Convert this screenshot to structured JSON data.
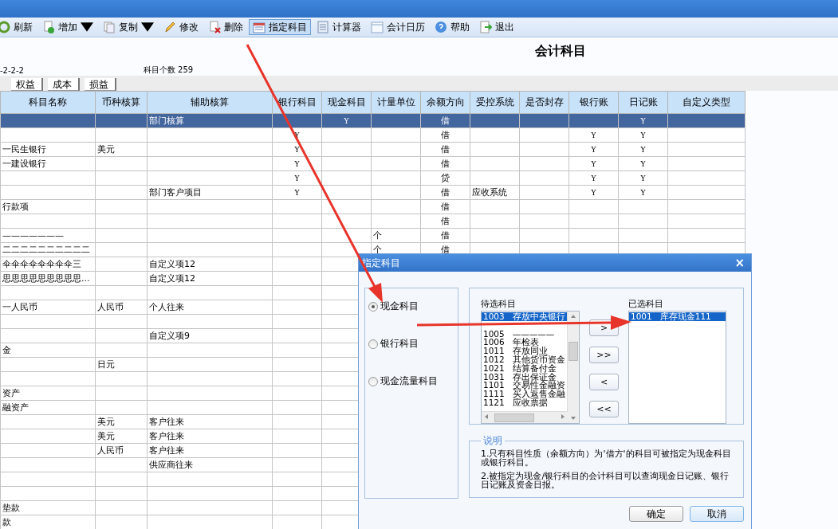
{
  "toolbar": [
    {
      "label": "刷新",
      "kind": "refresh",
      "dropdown": false,
      "active": false
    },
    {
      "label": "增加",
      "kind": "add",
      "dropdown": true,
      "active": false
    },
    {
      "label": "复制",
      "kind": "copy",
      "dropdown": true,
      "active": false
    },
    {
      "label": "修改",
      "kind": "edit",
      "dropdown": false,
      "active": false
    },
    {
      "label": "删除",
      "kind": "delete",
      "dropdown": false,
      "active": false
    },
    {
      "label": "指定科目",
      "kind": "assign",
      "dropdown": false,
      "active": true
    },
    {
      "label": "计算器",
      "kind": "calculator",
      "dropdown": false,
      "active": false
    },
    {
      "label": "会计日历",
      "kind": "calendar",
      "dropdown": false,
      "active": false
    },
    {
      "label": "帮助",
      "kind": "help",
      "dropdown": false,
      "active": false
    },
    {
      "label": "退出",
      "kind": "exit",
      "dropdown": false,
      "active": false
    }
  ],
  "page_title": "会计科目",
  "info": {
    "code_format": "-2-2-2",
    "count": "科目个数 259"
  },
  "tabs": [
    "权益",
    "成本",
    "损益"
  ],
  "table": {
    "columns": [
      "科目名称",
      "币种核算",
      "辅助核算",
      "银行科目",
      "现金科目",
      "计量单位",
      "余额方向",
      "受控系统",
      "是否封存",
      "银行账",
      "日记账",
      "自定义类型"
    ],
    "rows": [
      {
        "selected": true,
        "cells": [
          "",
          "",
          "部门核算",
          "",
          "Y",
          "",
          "借",
          "",
          "",
          "",
          "Y",
          ""
        ]
      },
      {
        "selected": false,
        "cells": [
          "",
          "",
          "",
          "Y",
          "",
          "",
          "借",
          "",
          "",
          "Y",
          "Y",
          ""
        ]
      },
      {
        "selected": false,
        "cells": [
          "一民生银行",
          "美元",
          "",
          "Y",
          "",
          "",
          "借",
          "",
          "",
          "Y",
          "Y",
          ""
        ]
      },
      {
        "selected": false,
        "cells": [
          "一建设银行",
          "",
          "",
          "Y",
          "",
          "",
          "借",
          "",
          "",
          "Y",
          "Y",
          ""
        ]
      },
      {
        "selected": false,
        "cells": [
          "",
          "",
          "",
          "Y",
          "",
          "",
          "贷",
          "",
          "",
          "Y",
          "Y",
          ""
        ]
      },
      {
        "selected": false,
        "cells": [
          "",
          "",
          "部门客户项目",
          "Y",
          "",
          "",
          "借",
          "应收系统",
          "",
          "Y",
          "Y",
          ""
        ]
      },
      {
        "selected": false,
        "cells": [
          "行款项",
          "",
          "",
          "",
          "",
          "",
          "借",
          "",
          "",
          "",
          "",
          ""
        ]
      },
      {
        "selected": false,
        "cells": [
          "",
          "",
          "",
          "",
          "",
          "",
          "借",
          "",
          "",
          "",
          "",
          ""
        ]
      },
      {
        "selected": false,
        "cells": [
          "———————",
          "",
          "",
          "",
          "",
          "个",
          "借",
          "",
          "",
          "",
          "",
          ""
        ]
      },
      {
        "selected": false,
        "cells": [
          "二二二二二二二二二二",
          "",
          "",
          "",
          "",
          "个",
          "借",
          "",
          "",
          "",
          "",
          ""
        ]
      },
      {
        "selected": false,
        "cells": [
          "伞伞伞伞伞伞伞伞三",
          "",
          "自定义项12",
          "",
          "",
          "",
          "",
          "",
          "",
          "",
          "",
          ""
        ]
      },
      {
        "selected": false,
        "cells": [
          "思思思思思思思思思...",
          "",
          "自定义项12",
          "",
          "",
          "",
          "",
          "",
          "",
          "",
          "",
          ""
        ]
      },
      {
        "selected": false,
        "cells": [
          "",
          "",
          "",
          "",
          "",
          "",
          "",
          "",
          "",
          "",
          "",
          ""
        ]
      },
      {
        "selected": false,
        "cells": [
          "一人民币",
          "人民币",
          "个人往来",
          "",
          "",
          "",
          "",
          "",
          "",
          "",
          "",
          ""
        ]
      },
      {
        "selected": false,
        "cells": [
          "",
          "",
          "",
          "",
          "",
          "",
          "",
          "",
          "",
          "",
          "",
          ""
        ]
      },
      {
        "selected": false,
        "cells": [
          "",
          "",
          "自定义项9",
          "",
          "",
          "",
          "",
          "",
          "",
          "",
          "",
          ""
        ]
      },
      {
        "selected": false,
        "cells": [
          "金",
          "",
          "",
          "",
          "",
          "",
          "",
          "",
          "",
          "",
          "",
          ""
        ]
      },
      {
        "selected": false,
        "cells": [
          "",
          "日元",
          "",
          "",
          "",
          "",
          "",
          "",
          "",
          "",
          "",
          ""
        ]
      },
      {
        "selected": false,
        "cells": [
          "",
          "",
          "",
          "",
          "",
          "",
          "",
          "",
          "",
          "",
          "",
          ""
        ]
      },
      {
        "selected": false,
        "cells": [
          "资产",
          "",
          "",
          "",
          "",
          "",
          "",
          "",
          "",
          "",
          "",
          ""
        ]
      },
      {
        "selected": false,
        "cells": [
          "融资产",
          "",
          "",
          "",
          "",
          "",
          "",
          "",
          "",
          "",
          "",
          ""
        ]
      },
      {
        "selected": false,
        "cells": [
          "",
          "美元",
          "客户往来",
          "",
          "",
          "",
          "",
          "",
          "",
          "",
          "",
          ""
        ]
      },
      {
        "selected": false,
        "cells": [
          "",
          "美元",
          "客户往来",
          "",
          "",
          "",
          "",
          "",
          "",
          "",
          "",
          ""
        ]
      },
      {
        "selected": false,
        "cells": [
          "",
          "人民币",
          "客户往来",
          "",
          "",
          "",
          "",
          "",
          "",
          "",
          "",
          ""
        ]
      },
      {
        "selected": false,
        "cells": [
          "",
          "",
          "供应商往来",
          "",
          "",
          "",
          "",
          "",
          "",
          "",
          "",
          ""
        ]
      },
      {
        "selected": false,
        "cells": [
          "",
          "",
          "",
          "",
          "",
          "",
          "",
          "",
          "",
          "",
          "",
          ""
        ]
      },
      {
        "selected": false,
        "cells": [
          "",
          "",
          "",
          "",
          "",
          "",
          "",
          "",
          "",
          "",
          "",
          ""
        ]
      },
      {
        "selected": false,
        "cells": [
          "垫款",
          "",
          "",
          "",
          "",
          "",
          "",
          "",
          "",
          "",
          "",
          ""
        ]
      },
      {
        "selected": false,
        "cells": [
          "款",
          "",
          "",
          "",
          "",
          "",
          "",
          "",
          "",
          "",
          "",
          ""
        ]
      }
    ]
  },
  "dialog": {
    "title": "指定科目",
    "close": "×",
    "types": [
      {
        "label": "现金科目",
        "selected": true
      },
      {
        "label": "银行科目",
        "selected": false
      },
      {
        "label": "现金流量科目",
        "selected": false
      }
    ],
    "available": {
      "label": "待选科目",
      "items": [
        {
          "text": "1003   存放中央银行",
          "selected": true
        },
        {
          "text": "1005   —————",
          "selected": false
        },
        {
          "text": "1006   年检表",
          "selected": false
        },
        {
          "text": "1011   存放同业",
          "selected": false
        },
        {
          "text": "1012   其他货币资金",
          "selected": false
        },
        {
          "text": "1021   结算备付金",
          "selected": false
        },
        {
          "text": "1031   存出保证金",
          "selected": false
        },
        {
          "text": "1101   交易性金融资",
          "selected": false
        },
        {
          "text": "1111   买入返售金融",
          "selected": false
        },
        {
          "text": "1121   应收票据",
          "selected": false
        }
      ]
    },
    "move_buttons": [
      ">",
      ">>",
      "<",
      "<<"
    ],
    "chosen": {
      "label": "已选科目",
      "items": [
        {
          "text": "1001   库存现金111",
          "selected": true
        }
      ]
    },
    "notes": {
      "title": "说明",
      "lines": [
        "1.只有科目性质（余额方向）为'借方'的科目可被指定为现金科目或银行科目。",
        "2.被指定为现金/银行科目的会计科目可以查询现金日记账、银行日记账及资金日报。"
      ]
    },
    "buttons": [
      "确定",
      "取消"
    ]
  }
}
